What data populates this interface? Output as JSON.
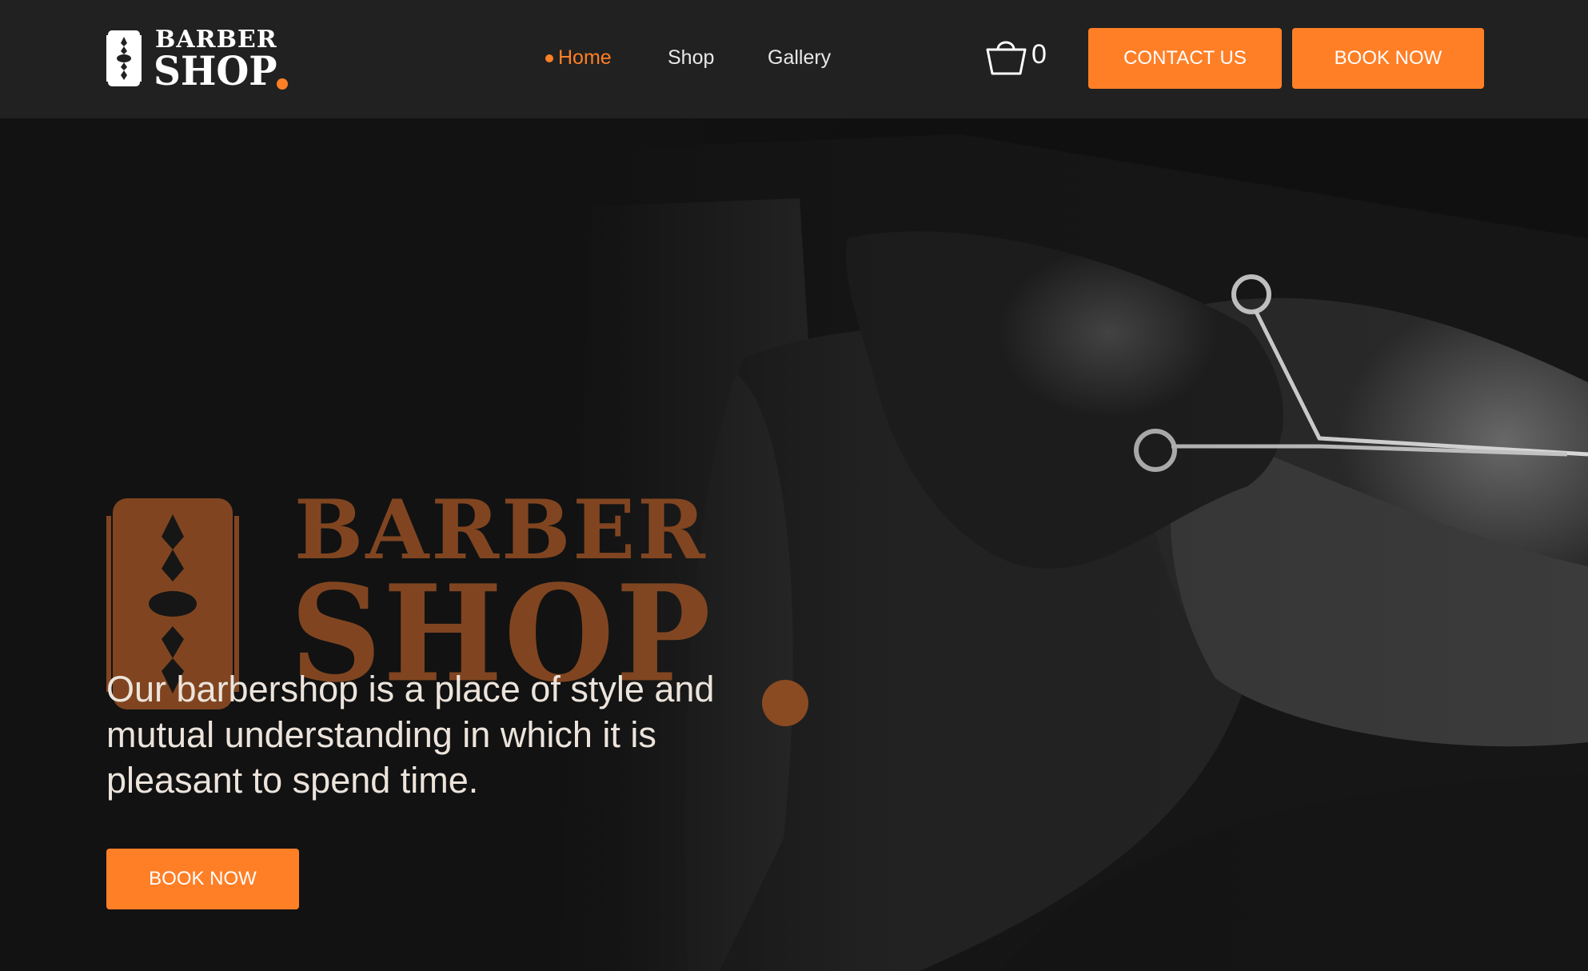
{
  "header": {
    "logo": {
      "line1": "BARBER",
      "line2": "SHOP",
      "icon": "razor-blade-icon"
    },
    "nav": [
      {
        "label": "Home",
        "active": true
      },
      {
        "label": "Shop",
        "active": false
      },
      {
        "label": "Gallery",
        "active": false
      }
    ],
    "cart": {
      "icon": "shopping-basket-icon",
      "count": "0"
    },
    "contact_label": "CONTACT US",
    "book_label": "BOOK NOW"
  },
  "hero": {
    "logo": {
      "line1": "BARBER",
      "line2": "SHOP",
      "icon": "razor-blade-icon"
    },
    "tagline": "Our barbershop is a place of style and mutual understanding in which it is pleasant to spend time.",
    "book_label": "BOOK NOW",
    "image": "barber-trimming-beard-with-scissors-photo"
  },
  "colors": {
    "accent": "#ff7f27",
    "header_bg": "#212121",
    "hero_logo": "#8a4a22",
    "text_light": "#ece4dc"
  }
}
